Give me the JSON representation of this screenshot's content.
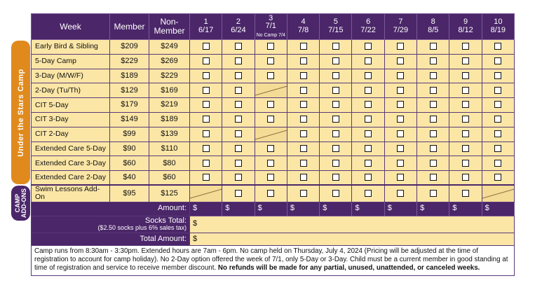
{
  "header": {
    "week_label": "Week",
    "member_label": "Member",
    "nonmember_label": "Non-\nMember",
    "weeks": [
      {
        "num": "1",
        "date": "6/17",
        "note": ""
      },
      {
        "num": "2",
        "date": "6/24",
        "note": ""
      },
      {
        "num": "3",
        "date": "7/1",
        "note": "No Camp 7/4"
      },
      {
        "num": "4",
        "date": "7/8",
        "note": ""
      },
      {
        "num": "5",
        "date": "7/15",
        "note": ""
      },
      {
        "num": "6",
        "date": "7/22",
        "note": ""
      },
      {
        "num": "7",
        "date": "7/29",
        "note": ""
      },
      {
        "num": "8",
        "date": "8/5",
        "note": ""
      },
      {
        "num": "9",
        "date": "8/12",
        "note": ""
      },
      {
        "num": "10",
        "date": "8/19",
        "note": ""
      }
    ]
  },
  "sections": {
    "camp_label": "Under the Stars Camp",
    "addons_label_1": "CAMP",
    "addons_label_2": "ADD-ONS"
  },
  "rows": [
    {
      "name": "Early Bird & Sibling",
      "member": "$209",
      "nonmember": "$249",
      "unavailable_weeks": []
    },
    {
      "name": "5-Day Camp",
      "member": "$229",
      "nonmember": "$269",
      "unavailable_weeks": []
    },
    {
      "name": "3-Day (M/W/F)",
      "member": "$189",
      "nonmember": "$229",
      "unavailable_weeks": []
    },
    {
      "name": "2-Day (Tu/Th)",
      "member": "$129",
      "nonmember": "$169",
      "unavailable_weeks": [
        3
      ]
    },
    {
      "name": "CIT 5-Day",
      "member": "$179",
      "nonmember": "$219",
      "unavailable_weeks": []
    },
    {
      "name": "CIT 3-Day",
      "member": "$149",
      "nonmember": "$189",
      "unavailable_weeks": []
    },
    {
      "name": "CIT 2-Day",
      "member": "$99",
      "nonmember": "$139",
      "unavailable_weeks": [
        3
      ]
    },
    {
      "name": "Extended Care 5-Day",
      "member": "$90",
      "nonmember": "$110",
      "unavailable_weeks": []
    },
    {
      "name": "Extended Care 3-Day",
      "member": "$60",
      "nonmember": "$80",
      "unavailable_weeks": []
    },
    {
      "name": "Extended Care 2-Day",
      "member": "$40",
      "nonmember": "$60",
      "unavailable_weeks": []
    },
    {
      "name": "Swim Lessons Add-On",
      "member": "$95",
      "nonmember": "$125",
      "unavailable_weeks": [
        1,
        10
      ]
    }
  ],
  "totals": {
    "amount_label": "Amount:",
    "currency": "$",
    "socks_label": "Socks Total:",
    "socks_note": "($2.50 socks plus 6% sales tax)",
    "total_label": "Total Amount:"
  },
  "footer": {
    "text": "Camp runs from 8:30am - 3:30pm.  Extended hours are 7am - 6pm.  No camp held on Thursday, July 4, 2024 (Pricing will be adjusted at the time of registration to account for camp holiday). No 2-Day option offered the week of 7/1, only 5-Day or 3-Day.  Child must be a current member in good standing at time of registration and service to receive member discount.",
    "bold": "No refunds will be made for any partial, unused, unattended, or canceled weeks."
  }
}
